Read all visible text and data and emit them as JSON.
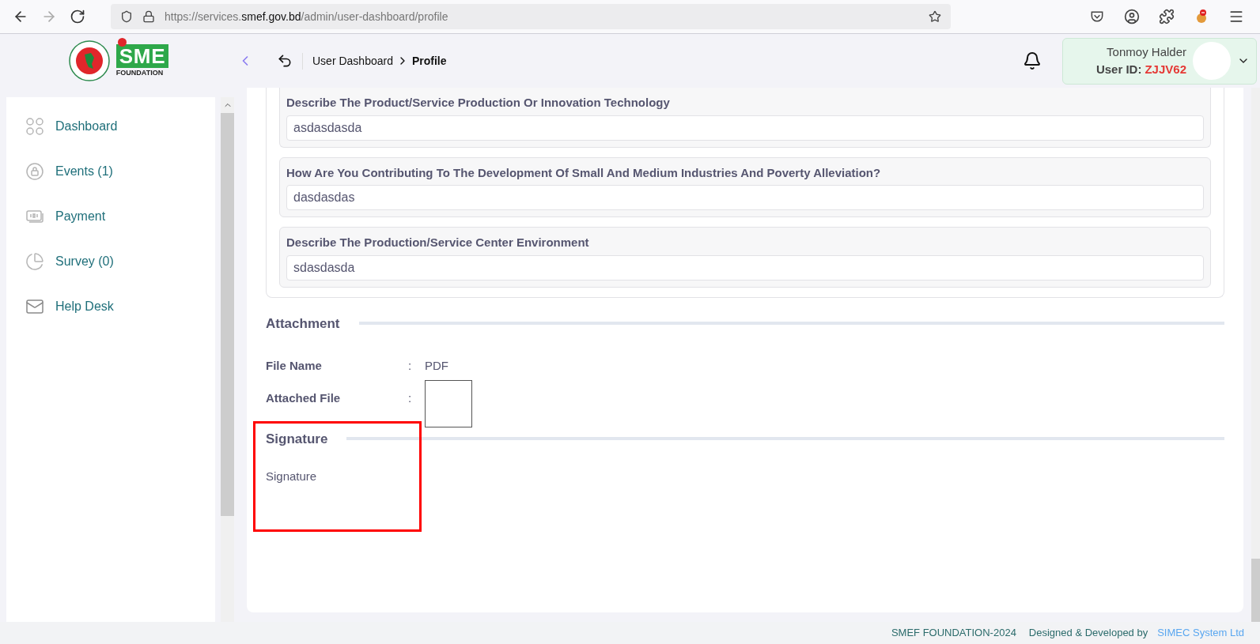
{
  "browser": {
    "url_prefix": "https://services.",
    "url_domain": "smef.gov.bd",
    "url_path": "/admin/user-dashboard/profile"
  },
  "header": {
    "logo": {
      "mark": "SME",
      "caption": "FOUNDATION"
    },
    "breadcrumb": [
      "User Dashboard",
      "Profile"
    ],
    "user": {
      "name": "Tonmoy Halder",
      "id_label": "User ID:",
      "id": "ZJJV62"
    }
  },
  "sidebar": {
    "items": [
      {
        "label": "Dashboard",
        "selected": false
      },
      {
        "label": "Events (1)",
        "selected": false
      },
      {
        "label": "Payment",
        "selected": false
      },
      {
        "label": "Survey (0)",
        "selected": false
      },
      {
        "label": "Help Desk",
        "selected": false
      }
    ]
  },
  "questions": [
    {
      "label": "Describe The Product/Service Production Or Innovation Technology",
      "value": "asdasdasda"
    },
    {
      "label": "How Are You Contributing To The Development Of Small And Medium Industries And Poverty Alleviation?",
      "value": "dasdasdas"
    },
    {
      "label": "Describe The Production/Service Center Environment",
      "value": "sdasdasda"
    }
  ],
  "attachment": {
    "title": "Attachment",
    "rows": [
      {
        "kind": "text",
        "label": "File Name",
        "separator": ":",
        "value": "PDF"
      },
      {
        "kind": "file",
        "label": "Attached File",
        "separator": ":"
      }
    ]
  },
  "signature": {
    "title": "Signature",
    "text": "Signature",
    "highlighted": true
  },
  "footer": {
    "copyright": "SMEF FOUNDATION-2024",
    "credit": "Designed & Developed by",
    "company": "SIMEC System Ltd"
  }
}
